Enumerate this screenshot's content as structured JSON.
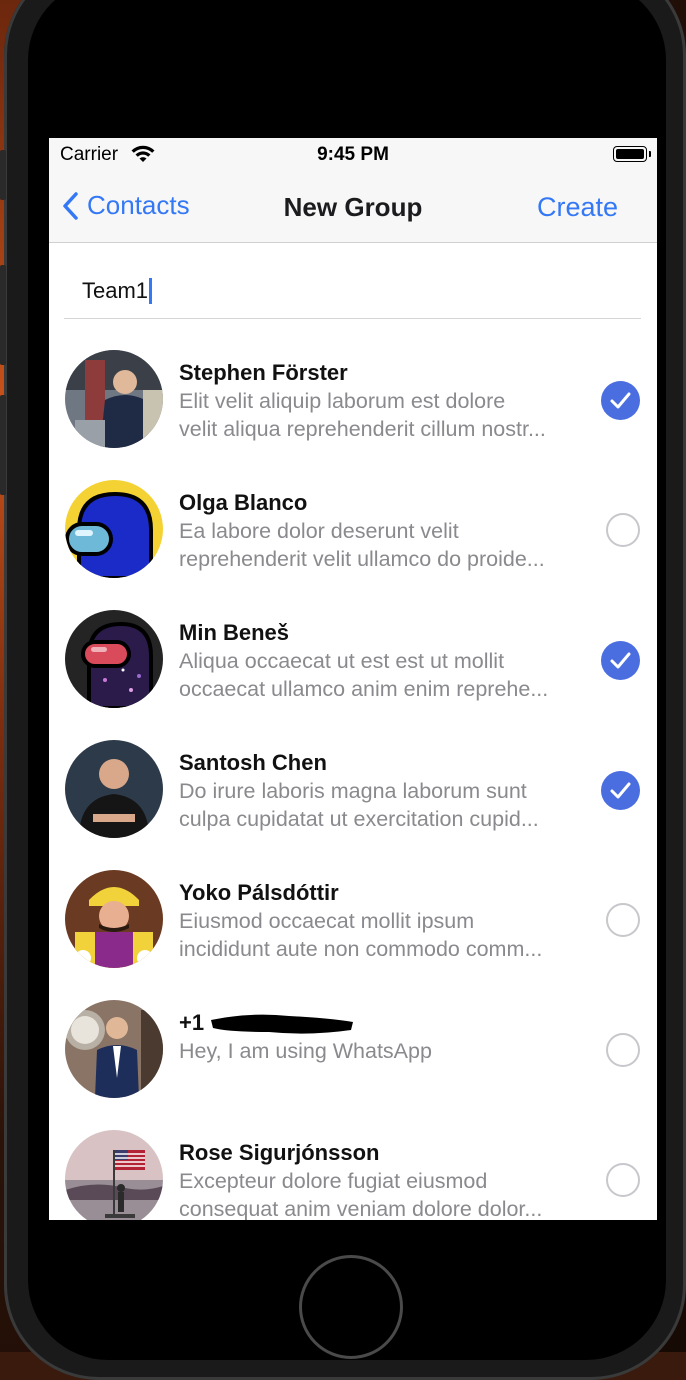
{
  "status_bar": {
    "carrier": "Carrier",
    "time": "9:45 PM"
  },
  "nav": {
    "back_label": "Contacts",
    "title": "New Group",
    "create_label": "Create"
  },
  "group_name": {
    "value": "Team1"
  },
  "contacts": [
    {
      "name": "Stephen Förster",
      "line1": "Elit velit aliquip laborum est dolore",
      "line2": "velit aliqua reprehenderit cillum nostr...",
      "selected": true
    },
    {
      "name": "Olga Blanco",
      "line1": "Ea labore dolor deserunt velit",
      "line2": "reprehenderit velit ullamco do proide...",
      "selected": false
    },
    {
      "name": "Min Beneš",
      "line1": "Aliqua occaecat ut est est ut mollit",
      "line2": "occaecat ullamco anim enim reprehe...",
      "selected": true
    },
    {
      "name": "Santosh Chen",
      "line1": "Do irure laboris magna laborum sunt",
      "line2": "culpa cupidatat ut exercitation cupid...",
      "selected": true
    },
    {
      "name": "Yoko Pálsdóttir",
      "line1": "Eiusmod occaecat mollit ipsum",
      "line2": "incididunt aute non commodo comm...",
      "selected": false
    },
    {
      "name": "+1",
      "line1": "Hey, I am using WhatsApp",
      "line2": "",
      "selected": false
    },
    {
      "name": "Rose Sigurjónsson",
      "line1": "Excepteur dolore fugiat eiusmod",
      "line2": "consequat anim veniam dolore dolor...",
      "selected": false
    }
  ],
  "icons": {
    "back": "chevron-left-icon",
    "wifi": "wifi-icon",
    "battery": "battery-icon",
    "check": "checkmark-icon"
  },
  "colors": {
    "accent": "#3478f6",
    "check": "#4a6ee0"
  }
}
